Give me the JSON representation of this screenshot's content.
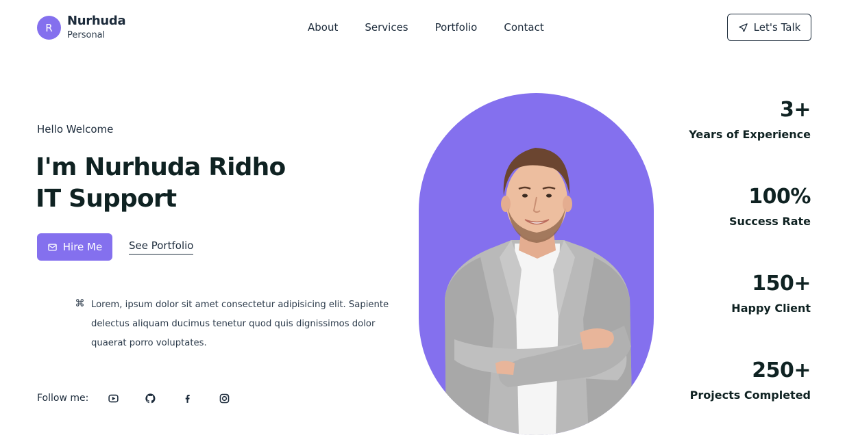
{
  "brand": {
    "avatar_letter": "R",
    "name": "Nurhuda",
    "subtitle": "Personal"
  },
  "nav": {
    "items": [
      "About",
      "Services",
      "Portfolio",
      "Contact"
    ]
  },
  "header": {
    "cta_label": "Let's Talk",
    "cta_icon": "send-icon"
  },
  "hero": {
    "greeting": "Hello Welcome",
    "title_line1": "I'm Nurhuda Ridho",
    "title_line2": "IT Support",
    "hire_label": "Hire Me",
    "hire_icon": "mail-icon",
    "portfolio_link": "See Portfolio",
    "description": "Lorem, ipsum dolor sit amet consectetur adipisicing elit. Sapiente delectus aliquam ducimus tenetur quod quis dignissimos dolor quaerat porro voluptates.",
    "description_icon": "command-icon"
  },
  "follow": {
    "label": "Follow me:",
    "icons": [
      "youtube-icon",
      "github-icon",
      "facebook-icon",
      "instagram-icon"
    ]
  },
  "stats": [
    {
      "value": "3+",
      "label": "Years of Experience"
    },
    {
      "value": "100%",
      "label": "Success Rate"
    },
    {
      "value": "150+",
      "label": "Happy Client"
    },
    {
      "value": "250+",
      "label": "Projects Completed"
    }
  ],
  "colors": {
    "accent": "#8470ee",
    "text_dark": "#0f2222",
    "background": "#ffffff"
  }
}
